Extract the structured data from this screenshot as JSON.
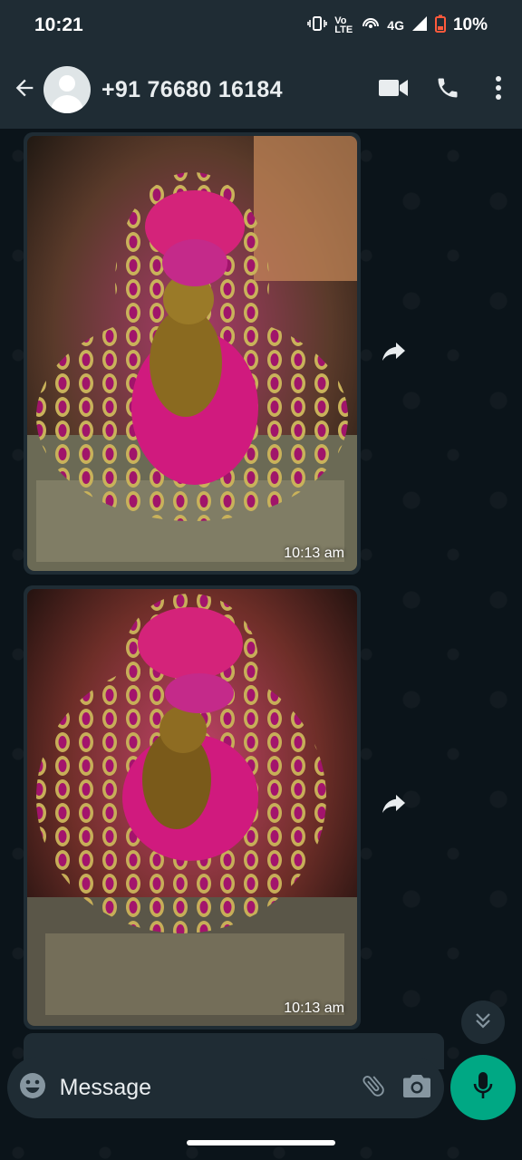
{
  "status_bar": {
    "time": "10:21",
    "network_label": "4G",
    "volte_label": "Vo LTE",
    "battery": "10%",
    "battery_color": "#ff5a3c"
  },
  "header": {
    "contact_name": "+91 76680 16184",
    "back_icon": "arrow-back-icon",
    "avatar_icon": "default-avatar-icon",
    "actions": [
      "video-call-icon",
      "phone-icon",
      "more-vert-icon"
    ]
  },
  "messages": [
    {
      "type": "image",
      "description_icon": "photo",
      "time": "10:13 am"
    },
    {
      "type": "image",
      "description_icon": "photo",
      "time": "10:13 am"
    }
  ],
  "composer": {
    "placeholder": "Message",
    "emoji_icon": "emoji-icon",
    "attach_icon": "paperclip-icon",
    "camera_icon": "camera-icon",
    "mic_icon": "mic-icon"
  },
  "colors": {
    "header_bg": "#1f2c34",
    "chat_bg": "#0b141a",
    "accent": "#00a884"
  }
}
